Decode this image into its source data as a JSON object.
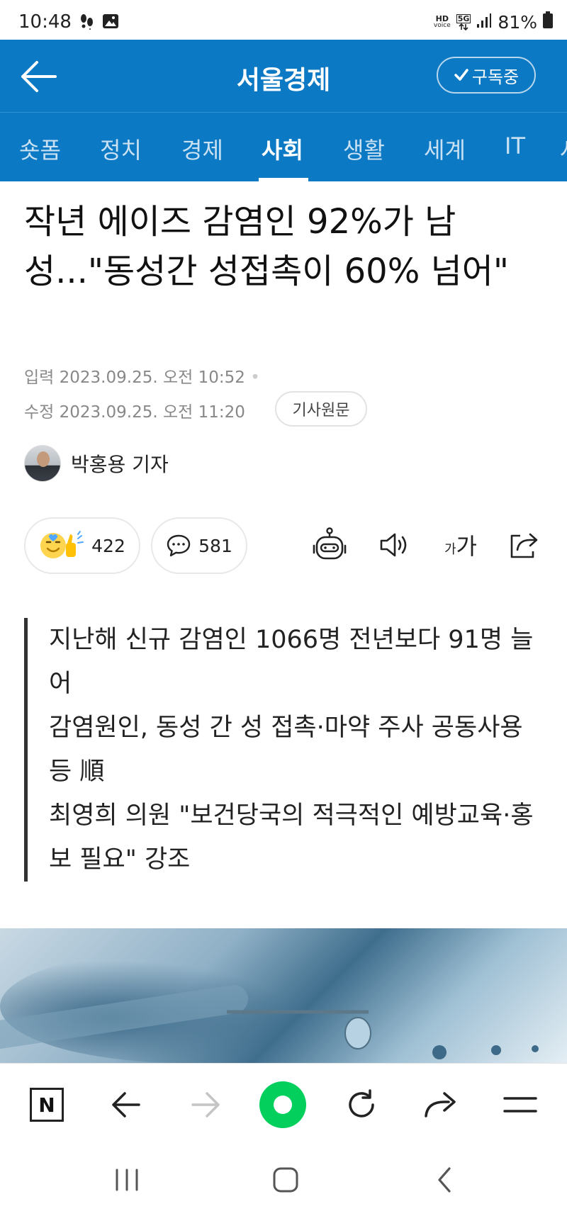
{
  "status_bar": {
    "time": "10:48",
    "hd_label": "HD",
    "voice_label": "voice",
    "network_label": "5G",
    "battery": "81%"
  },
  "header": {
    "title": "서울경제",
    "subscribe_label": "구독중"
  },
  "tabs": [
    {
      "label": "숏폼"
    },
    {
      "label": "정치"
    },
    {
      "label": "경제"
    },
    {
      "label": "사회"
    },
    {
      "label": "생활"
    },
    {
      "label": "세계"
    },
    {
      "label": "IT"
    },
    {
      "label": "사"
    }
  ],
  "active_tab": "사회",
  "article": {
    "headline": "작년 에이즈 감염인 92%가 남성...\"동성간 성접촉이 60% 넘어\"",
    "input_label": "입력",
    "input_date": "2023.09.25. 오전 10:52",
    "modified_label": "수정",
    "modified_date": "2023.09.25. 오전 11:20",
    "original_button": "기사원문",
    "reporter": "박홍용 기자",
    "reaction_count": "422",
    "comment_count": "581",
    "font_size_label_small": "가",
    "font_size_label_large": "가",
    "summary": [
      "지난해 신규 감염인 1066명 전년보다 91명 늘어",
      "감염원인, 동성 간 성 접촉·마약 주사 공동사용 등 順",
      "최영희 의원 \"보건당국의 적극적인 예방교육·홍보 필요\" 강조"
    ]
  },
  "browser_bar": {
    "home_label": "N"
  },
  "colors": {
    "brand_blue": "#0b79c4",
    "naver_green": "#03cf5d"
  }
}
